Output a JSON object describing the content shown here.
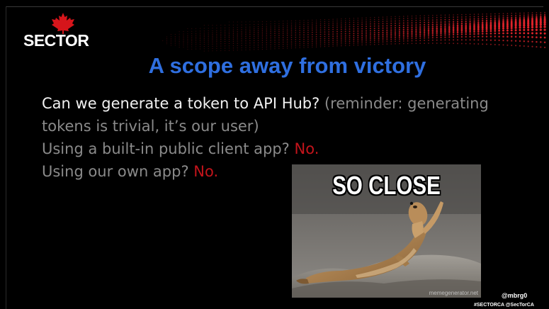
{
  "logo": {
    "text": "SECTOR",
    "leaf_color": "#d6151b"
  },
  "title": "A scope away from victory",
  "bullets": [
    {
      "line1_main": "Can we generate a token to API Hub?",
      "line1_note": " (reminder: generating",
      "line2_note": "tokens is trivial, it’s our user)"
    },
    {
      "main": "Using a built-in public client app?",
      "answer": " No."
    },
    {
      "main": "Using our own app?",
      "answer": " No."
    }
  ],
  "meme": {
    "caption": "SO CLOSE",
    "watermark": "memegenerator.net"
  },
  "footer": {
    "handle": "@mbrg0",
    "hashtags": "#SECTORCA @SecTorCA"
  },
  "colors": {
    "title": "#2f6fe0",
    "answer_red": "#c3141b",
    "primary_text": "#f2f2f2",
    "secondary_text": "#8a8a8a",
    "background": "#000000"
  }
}
